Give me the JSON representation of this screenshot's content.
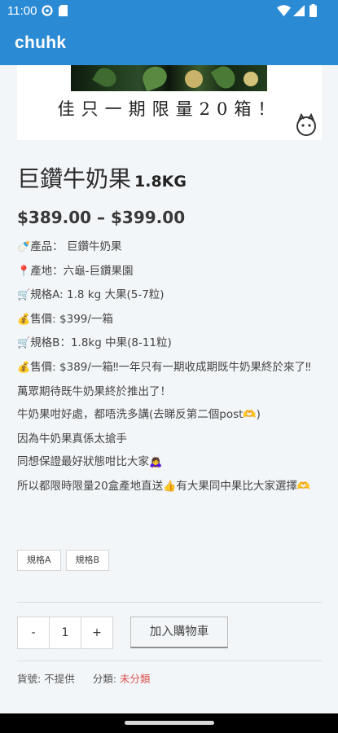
{
  "status_bar": {
    "time": "11:00"
  },
  "app_bar": {
    "title": "chuhk"
  },
  "banner": {
    "slogan": "佳只一期限量20箱！"
  },
  "product": {
    "title": "巨鑽牛奶果",
    "weight": "1.8KG",
    "price_range": "$389.00 – $399.00"
  },
  "description": {
    "line1_icon": "🍼",
    "line1": "產品： 巨鑽牛奶果",
    "line2_icon": "📍",
    "line2": "產地：六龜-巨鑽果園",
    "line3_icon": "🛒",
    "line3": "規格A: 1.8 kg 大果(5-7粒)",
    "line4_icon": "💰",
    "line4": "售價: $399/一箱",
    "line5_icon": "🛒",
    "line5": "規格B：1.8kg 中果(8-11粒)",
    "line6_icon": "💰",
    "line6": "售價: $389/一箱‼一年只有一期收成期既牛奶果終於來了‼",
    "line7": "萬眾期待既牛奶果終於推出了！",
    "line8": "牛奶果咁好處，都唔洗多講(去睇反第二個post",
    "line8_emoji": "🫶",
    "line8_end": ")",
    "line9": "因為牛奶果真係太搶手",
    "line10": "同想保證最好狀態咁比大家",
    "line10_emoji": "🙇‍♀️",
    "line11": "所以都限時限量20盒產地直送",
    "line11_emoji": "👍",
    "line11_end": "有大果同中果比大家選擇",
    "line11_end_emoji": "🫶"
  },
  "variants": [
    "規格A",
    "規格B"
  ],
  "quantity": {
    "minus": "-",
    "value": "1",
    "plus": "+"
  },
  "add_to_cart": "加入購物車",
  "meta": {
    "sku_label": "貨號:",
    "sku_value": "不提供",
    "category_label": "分類:",
    "category_value": "未分類"
  },
  "colors": {
    "app_bar": "#2a8ad4",
    "category_link": "#d9534f",
    "page_bg": "#f3f6f8"
  },
  "icons": [
    "gear-icon",
    "sim-card-icon",
    "wifi-icon",
    "signal-icon",
    "battery-icon"
  ]
}
